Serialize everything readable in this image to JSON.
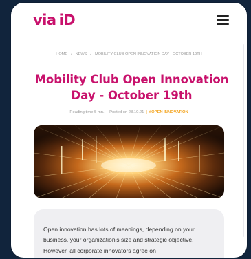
{
  "header": {
    "logo_via": "via",
    "logo_id": "iD",
    "menu_icon": "hamburger-menu-icon"
  },
  "breadcrumb": {
    "home": "HOME",
    "news": "NEWS",
    "current": "MOBILITY CLUB OPEN INNOVATION DAY - OCTOBER 19TH",
    "separator": "/"
  },
  "article": {
    "title": "Mobility Club Open Innovation Day - October 19th",
    "reading_time": "Reading time 5 mn.",
    "posted_on": "Posted on 28.10.21",
    "tag": "#OPEN INNOVATION",
    "meta_separator": "|",
    "intro": "Open innovation has lots of meanings, depending on your business, your organization's size and strategic objective. However, all corporate innovators agree on"
  },
  "colors": {
    "brand": "#c8116c",
    "accent": "#f3a21a",
    "background": "#11243c"
  }
}
